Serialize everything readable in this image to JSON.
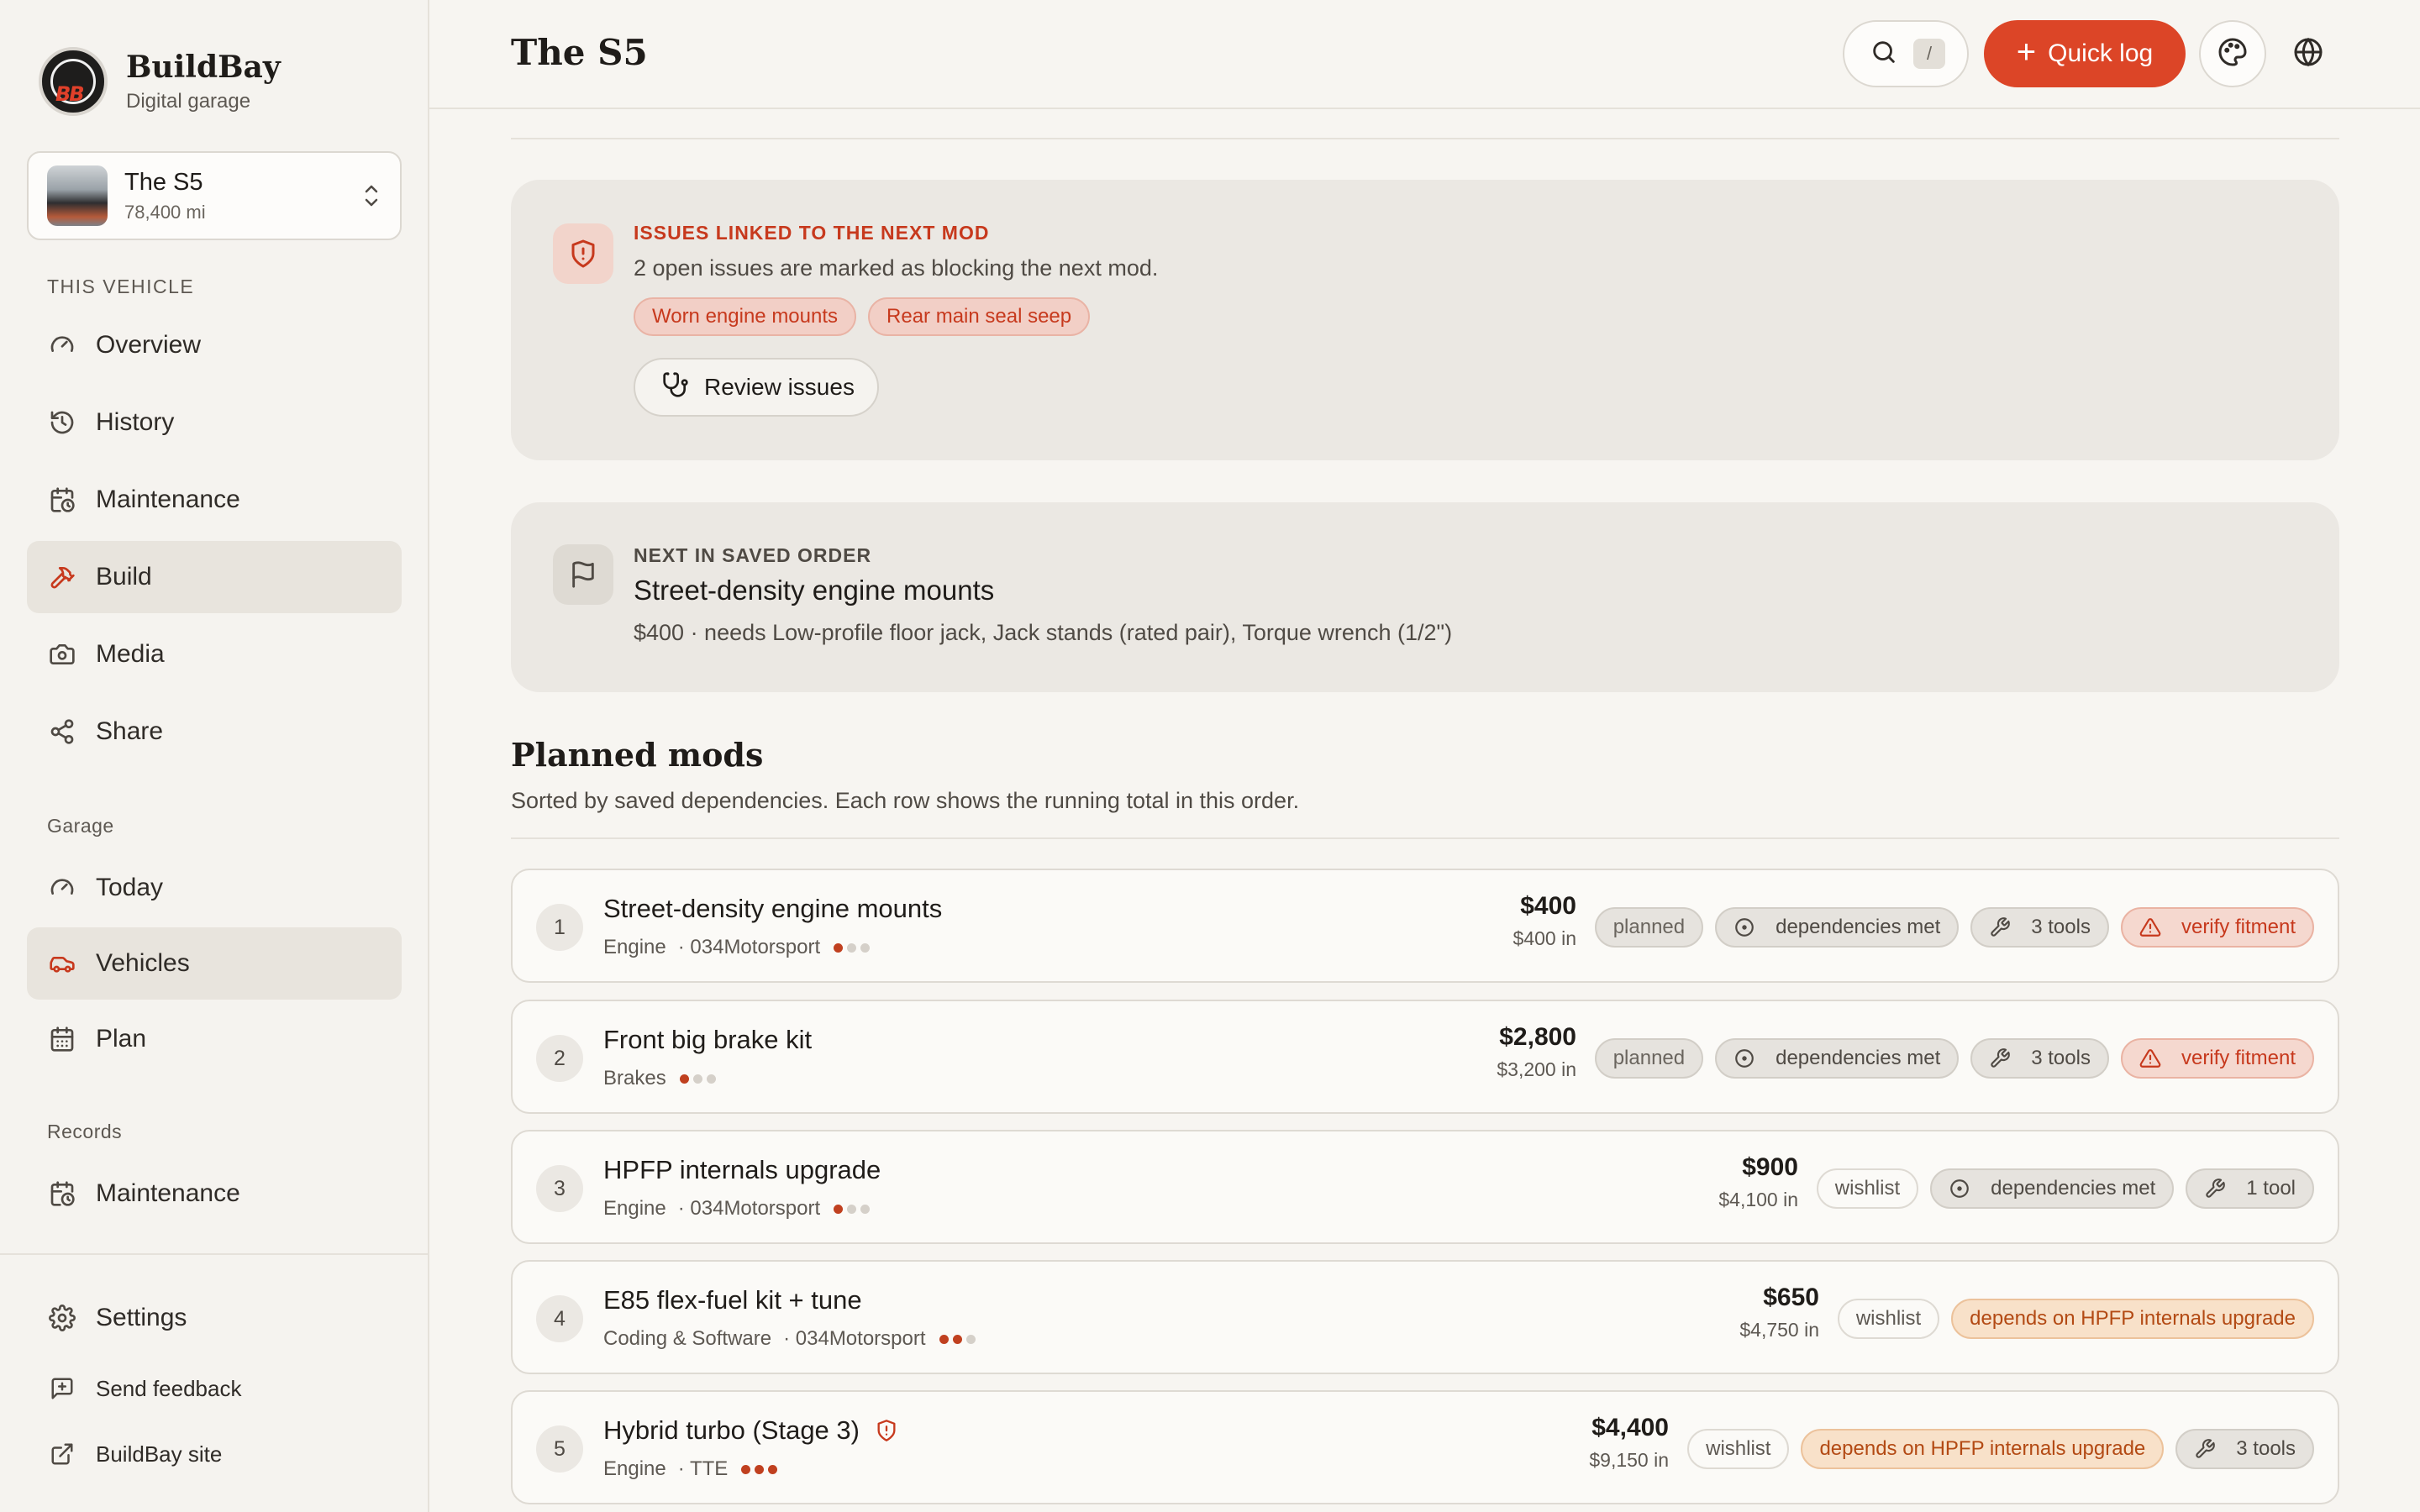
{
  "brand": {
    "name": "BuildBay",
    "subtitle": "Digital garage",
    "logo_text": "BB"
  },
  "vehicle": {
    "name": "The S5",
    "mileage": "78,400 mi"
  },
  "sidebar": {
    "section_vehicle": "THIS VEHICLE",
    "vehicle_items": [
      {
        "label": "Overview",
        "icon": "gauge-icon"
      },
      {
        "label": "History",
        "icon": "history-icon"
      },
      {
        "label": "Maintenance",
        "icon": "calendar-clock-icon"
      },
      {
        "label": "Build",
        "icon": "hammer-icon",
        "active": true
      },
      {
        "label": "Media",
        "icon": "camera-icon"
      },
      {
        "label": "Share",
        "icon": "share-icon"
      }
    ],
    "section_garage": "Garage",
    "garage_items": [
      {
        "label": "Today",
        "icon": "gauge-icon"
      },
      {
        "label": "Vehicles",
        "icon": "car-icon",
        "active": true
      },
      {
        "label": "Plan",
        "icon": "calendar-icon"
      }
    ],
    "section_records": "Records",
    "records_items": [
      {
        "label": "Maintenance",
        "icon": "calendar-clock-icon"
      }
    ],
    "footer_items": [
      {
        "label": "Settings",
        "icon": "gear-icon"
      },
      {
        "label": "Send feedback",
        "icon": "feedback-icon"
      },
      {
        "label": "BuildBay site",
        "icon": "external-link-icon"
      }
    ]
  },
  "topbar": {
    "title": "The S5",
    "search_shortcut": "/",
    "quick_log_label": "Quick log"
  },
  "issues_card": {
    "eyebrow": "ISSUES LINKED TO THE NEXT MOD",
    "description": "2 open issues are marked as blocking the next mod.",
    "tags": [
      "Worn engine mounts",
      "Rear main seal seep"
    ],
    "review_label": "Review issues"
  },
  "next_card": {
    "eyebrow": "NEXT IN SAVED ORDER",
    "title": "Street-density engine mounts",
    "description": "$400 · needs Low-profile floor jack, Jack stands (rated pair), Torque wrench (1/2\")"
  },
  "planned": {
    "title": "Planned mods",
    "subtitle": "Sorted by saved dependencies. Each row shows the running total in this order.",
    "mods": [
      {
        "num": "1",
        "name": "Street-density engine mounts",
        "category": "Engine",
        "vendor": "· 034Motorsport",
        "difficulty": 1,
        "price": "$400",
        "running": "$400 in",
        "chips": [
          {
            "label": "planned",
            "kind": "planned"
          },
          {
            "label": "dependencies met",
            "kind": "neutral",
            "icon": "check-circle-icon"
          },
          {
            "label": "3 tools",
            "kind": "neutral",
            "icon": "wrench-icon"
          },
          {
            "label": "verify fitment",
            "kind": "warn",
            "icon": "warning-icon"
          }
        ]
      },
      {
        "num": "2",
        "name": "Front big brake kit",
        "category": "Brakes",
        "vendor": "",
        "difficulty": 1,
        "price": "$2,800",
        "running": "$3,200 in",
        "chips": [
          {
            "label": "planned",
            "kind": "planned"
          },
          {
            "label": "dependencies met",
            "kind": "neutral",
            "icon": "check-circle-icon"
          },
          {
            "label": "3 tools",
            "kind": "neutral",
            "icon": "wrench-icon"
          },
          {
            "label": "verify fitment",
            "kind": "warn",
            "icon": "warning-icon"
          }
        ]
      },
      {
        "num": "3",
        "name": "HPFP internals upgrade",
        "category": "Engine",
        "vendor": "· 034Motorsport",
        "difficulty": 1,
        "price": "$900",
        "running": "$4,100 in",
        "chips": [
          {
            "label": "wishlist",
            "kind": "wishlist"
          },
          {
            "label": "dependencies met",
            "kind": "neutral",
            "icon": "check-circle-icon"
          },
          {
            "label": "1 tool",
            "kind": "neutral",
            "icon": "wrench-icon"
          }
        ]
      },
      {
        "num": "4",
        "name": "E85 flex-fuel kit + tune",
        "category": "Coding & Software",
        "vendor": "· 034Motorsport",
        "difficulty": 2,
        "price": "$650",
        "running": "$4,750 in",
        "chips": [
          {
            "label": "wishlist",
            "kind": "wishlist"
          },
          {
            "label": "depends on HPFP internals upgrade",
            "kind": "depends"
          }
        ]
      },
      {
        "num": "5",
        "name": "Hybrid turbo (Stage 3)",
        "category": "Engine",
        "vendor": "· TTE",
        "difficulty": 3,
        "price": "$4,400",
        "running": "$9,150 in",
        "flagged": true,
        "chips": [
          {
            "label": "wishlist",
            "kind": "wishlist"
          },
          {
            "label": "depends on HPFP internals upgrade",
            "kind": "depends"
          },
          {
            "label": "3 tools",
            "kind": "neutral",
            "icon": "wrench-icon"
          }
        ]
      }
    ]
  },
  "colors": {
    "accent": "#dc4527",
    "warn": "#c7391d",
    "depends": "#b34a14",
    "card": "#ebe8e3"
  }
}
